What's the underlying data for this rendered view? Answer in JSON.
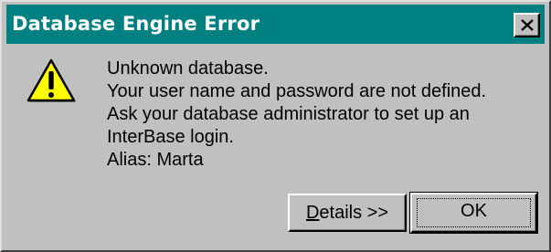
{
  "dialog": {
    "title": "Database Engine Error",
    "close_label": "×",
    "icon": "warning-icon",
    "message_lines": [
      "Unknown database.",
      "Your user name and password are not defined.",
      "Ask your database administrator to set up an",
      "InterBase login.",
      "Alias: Marta"
    ],
    "buttons": {
      "details": {
        "accel": "D",
        "rest": "etails >>"
      },
      "ok": "OK"
    }
  },
  "colors": {
    "titlebar": "#008080",
    "face": "#c0c0c0",
    "warning_fill": "#ffff00"
  }
}
